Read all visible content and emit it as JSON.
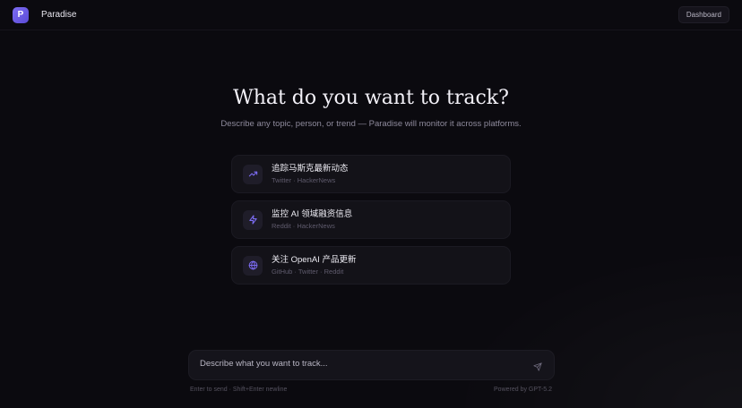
{
  "header": {
    "logo_letter": "P",
    "app_name": "Paradise",
    "dashboard_label": "Dashboard"
  },
  "hero": {
    "title": "What do you want to track?",
    "subtitle": "Describe any topic, person, or trend — Paradise will monitor it across platforms."
  },
  "suggestions": [
    {
      "icon": "trending-up-icon",
      "title": "追踪马斯克最新动态",
      "sources": "Twitter · HackerNews"
    },
    {
      "icon": "lightning-icon",
      "title": "监控 AI 领域融资信息",
      "sources": "Reddit · HackerNews"
    },
    {
      "icon": "globe-icon",
      "title": "关注 OpenAI 产品更新",
      "sources": "GitHub · Twitter · Reddit"
    }
  ],
  "composer": {
    "placeholder": "Describe what you want to track...",
    "value": "",
    "hint": "Enter to send · Shift+Enter newline",
    "powered_by": "Powered by GPT-5.2"
  },
  "colors": {
    "accent": "#6c5ce7",
    "icon_accent": "#7c6cf2",
    "background": "#0b0a0f",
    "card": "#131218"
  }
}
